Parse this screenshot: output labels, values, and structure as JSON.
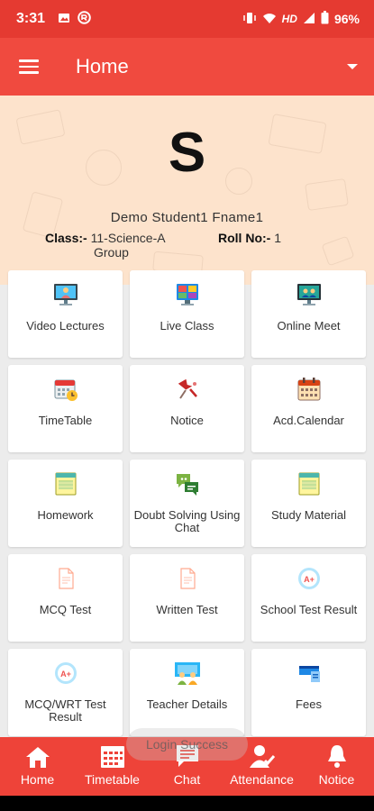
{
  "status_bar": {
    "time": "3:31",
    "network": "HD",
    "battery": "96%"
  },
  "app_bar": {
    "title": "Home"
  },
  "profile": {
    "initial": "S",
    "name": "Demo Student1 Fname1",
    "class_label": "Class:-",
    "class_value": "11-Science-A",
    "class_group": "Group",
    "roll_label": "Roll No:-",
    "roll_value": "1"
  },
  "tiles": [
    {
      "label": "Video Lectures",
      "icon": "video-lecture-icon"
    },
    {
      "label": "Live Class",
      "icon": "live-class-icon"
    },
    {
      "label": "Online Meet",
      "icon": "online-meet-icon"
    },
    {
      "label": "TimeTable",
      "icon": "timetable-icon"
    },
    {
      "label": "Notice",
      "icon": "pushpin-icon"
    },
    {
      "label": "Acd.Calendar",
      "icon": "calendar-icon"
    },
    {
      "label": "Homework",
      "icon": "notebook-icon"
    },
    {
      "label": "Doubt Solving Using Chat",
      "icon": "chat-bubbles-icon"
    },
    {
      "label": "Study Material",
      "icon": "notebook-icon"
    },
    {
      "label": "MCQ Test",
      "icon": "test-document-icon"
    },
    {
      "label": "Written Test",
      "icon": "test-document-icon"
    },
    {
      "label": "School Test Result",
      "icon": "result-badge-icon"
    },
    {
      "label": "MCQ/WRT Test Result",
      "icon": "result-badge-icon"
    },
    {
      "label": "Teacher Details",
      "icon": "teachers-icon"
    },
    {
      "label": "Fees",
      "icon": "fees-icon"
    }
  ],
  "toast": "Login Success",
  "bottom_nav": [
    {
      "label": "Home",
      "icon": "home-icon"
    },
    {
      "label": "Timetable",
      "icon": "calendar-grid-icon"
    },
    {
      "label": "Chat",
      "icon": "chat-icon"
    },
    {
      "label": "Attendance",
      "icon": "attendance-icon"
    },
    {
      "label": "Notice",
      "icon": "bell-icon"
    }
  ],
  "colors": {
    "status_bar": "#e53a31",
    "app_bar": "#f04a3f",
    "bottom_nav": "#ee4339",
    "profile_bg": "#fde3cc"
  }
}
